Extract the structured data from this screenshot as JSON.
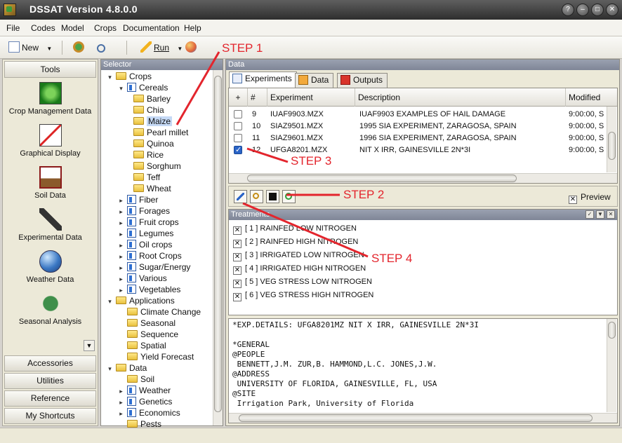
{
  "window": {
    "title": "DSSAT Version 4.8.0.0"
  },
  "menu": [
    "File",
    "Codes",
    "Model",
    "Crops",
    "Documentation",
    "Help"
  ],
  "toolbar": {
    "new_label": "New",
    "run_label": "Run"
  },
  "tools": {
    "header": "Tools",
    "items": [
      "Crop Management Data",
      "Graphical Display",
      "Soil Data",
      "Experimental Data",
      "Weather Data",
      "Seasonal Analysis"
    ],
    "sections": [
      "Accessories",
      "Utilities",
      "Reference",
      "My Shortcuts"
    ]
  },
  "selector": {
    "header": "Selector",
    "tree": [
      {
        "label": "Crops",
        "level": 0,
        "icon": "folder",
        "exp": "-"
      },
      {
        "label": "Cereals",
        "level": 1,
        "icon": "book",
        "exp": "-"
      },
      {
        "label": "Barley",
        "level": 2,
        "icon": "folder",
        "exp": ""
      },
      {
        "label": "Chia",
        "level": 2,
        "icon": "folder",
        "exp": ""
      },
      {
        "label": "Maize",
        "level": 2,
        "icon": "folder",
        "exp": "",
        "selected": true
      },
      {
        "label": "Pearl millet",
        "level": 2,
        "icon": "folder",
        "exp": ""
      },
      {
        "label": "Quinoa",
        "level": 2,
        "icon": "folder",
        "exp": ""
      },
      {
        "label": "Rice",
        "level": 2,
        "icon": "folder",
        "exp": ""
      },
      {
        "label": "Sorghum",
        "level": 2,
        "icon": "folder",
        "exp": ""
      },
      {
        "label": "Teff",
        "level": 2,
        "icon": "folder",
        "exp": ""
      },
      {
        "label": "Wheat",
        "level": 2,
        "icon": "folder",
        "exp": ""
      },
      {
        "label": "Fiber",
        "level": 1,
        "icon": "book",
        "exp": "+"
      },
      {
        "label": "Forages",
        "level": 1,
        "icon": "book",
        "exp": "+"
      },
      {
        "label": "Fruit crops",
        "level": 1,
        "icon": "book",
        "exp": "+"
      },
      {
        "label": "Legumes",
        "level": 1,
        "icon": "book",
        "exp": "+"
      },
      {
        "label": "Oil crops",
        "level": 1,
        "icon": "book",
        "exp": "+"
      },
      {
        "label": "Root Crops",
        "level": 1,
        "icon": "book",
        "exp": "+"
      },
      {
        "label": "Sugar/Energy",
        "level": 1,
        "icon": "book",
        "exp": "+"
      },
      {
        "label": "Various",
        "level": 1,
        "icon": "book",
        "exp": "+"
      },
      {
        "label": "Vegetables",
        "level": 1,
        "icon": "book",
        "exp": "+"
      },
      {
        "label": "Applications",
        "level": 0,
        "icon": "folder",
        "exp": "-"
      },
      {
        "label": "Climate Change",
        "level": 1,
        "icon": "folder",
        "exp": ""
      },
      {
        "label": "Seasonal",
        "level": 1,
        "icon": "folder",
        "exp": ""
      },
      {
        "label": "Sequence",
        "level": 1,
        "icon": "folder",
        "exp": ""
      },
      {
        "label": "Spatial",
        "level": 1,
        "icon": "folder",
        "exp": ""
      },
      {
        "label": "Yield Forecast",
        "level": 1,
        "icon": "folder",
        "exp": ""
      },
      {
        "label": "Data",
        "level": 0,
        "icon": "folder",
        "exp": "-"
      },
      {
        "label": "Soil",
        "level": 1,
        "icon": "folder",
        "exp": ""
      },
      {
        "label": "Weather",
        "level": 1,
        "icon": "book",
        "exp": "+"
      },
      {
        "label": "Genetics",
        "level": 1,
        "icon": "book",
        "exp": "+"
      },
      {
        "label": "Economics",
        "level": 1,
        "icon": "book",
        "exp": "+"
      },
      {
        "label": "Pests",
        "level": 1,
        "icon": "folder",
        "exp": ""
      }
    ]
  },
  "data_panel": {
    "header": "Data",
    "tabs": [
      "Experiments",
      "Data",
      "Outputs"
    ],
    "columns": [
      "+",
      "#",
      "Experiment",
      "Description",
      "Modified"
    ],
    "rows": [
      {
        "checked": false,
        "num": "9",
        "experiment": "IUAF9903.MZX",
        "description": "IUAF9903 EXAMPLES OF HAIL DAMAGE",
        "modified": "9:00:00, S"
      },
      {
        "checked": false,
        "num": "10",
        "experiment": "SIAZ9501.MZX",
        "description": "1995 SIA EXPERIMENT, ZARAGOSA, SPAIN",
        "modified": "9:00:00, S"
      },
      {
        "checked": false,
        "num": "11",
        "experiment": "SIAZ9601.MZX",
        "description": "1996 SIA EXPERIMENT, ZARAGOSA, SPAIN",
        "modified": "9:00:00, S"
      },
      {
        "checked": true,
        "num": "12",
        "experiment": "UFGA8201.MZX",
        "description": "NIT X IRR, GAINESVILLE 2N*3I",
        "modified": "9:00:00, S"
      }
    ],
    "preview_label": "Preview",
    "preview_mark": "✕",
    "treatments_header": "Treatments",
    "treatments": [
      "[ 1 ] RAINFED LOW NITROGEN",
      "[ 2 ] RAINFED HIGH NITROGEN",
      "[ 3 ] IRRIGATED LOW NITROGEN",
      "[ 4 ] IRRIGATED HIGH NITROGEN",
      "[ 5 ] VEG STRESS LOW NITROGEN",
      "[ 6 ] VEG STRESS HIGH NITROGEN"
    ],
    "file_lines": [
      "*EXP.DETAILS: UFGA8201MZ NIT X IRR, GAINESVILLE 2N*3I",
      "",
      "*GENERAL",
      "@PEOPLE",
      " BENNETT,J.M. ZUR,B. HAMMOND,L.C. JONES,J.W.",
      "@ADDRESS",
      " UNIVERSITY OF FLORIDA, GAINESVILLE, FL, USA",
      "@SITE",
      " Irrigation Park, University of Florida"
    ]
  },
  "annotations": [
    "STEP 1",
    "STEP 2",
    "STEP 3",
    "STEP 4"
  ],
  "colors": {
    "annotation": "#e3252d",
    "selection": "#c5d9f5",
    "panel_header": "#8a91a2"
  }
}
